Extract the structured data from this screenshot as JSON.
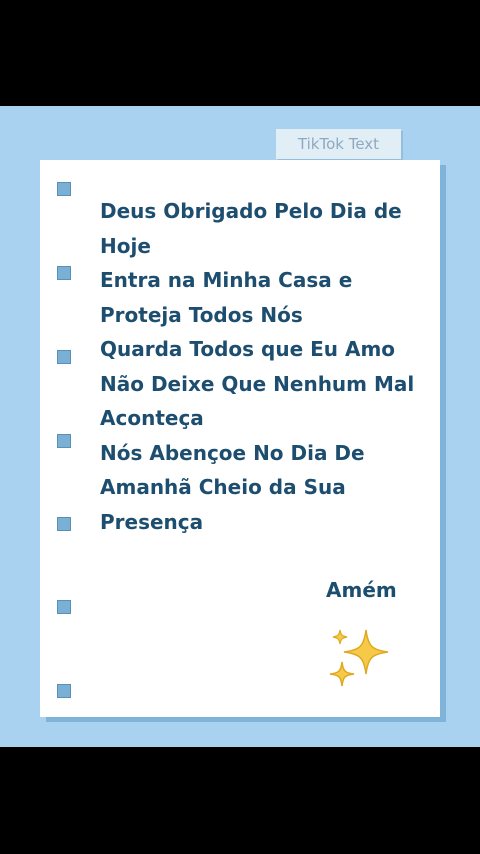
{
  "tag": {
    "label": "TikTok Text"
  },
  "note": {
    "lines": [
      "Deus Obrigado Pelo Dia de",
      "Hoje",
      "Entra na Minha Casa e",
      "Proteja Todos Nós",
      "Quarda Todos que Eu Amo",
      "Não Deixe Que Nenhum Mal",
      "Aconteça",
      "Nós Abençoe No Dia De",
      "Amanhã Cheio da Sua",
      "Presença"
    ],
    "closing": "Amém",
    "decoration_icon": "sparkles-icon"
  },
  "colors": {
    "background": "#a8d2ef",
    "text": "#1e4e6f",
    "hole": "#7ab0d6",
    "sparkle": "#f7c948"
  }
}
